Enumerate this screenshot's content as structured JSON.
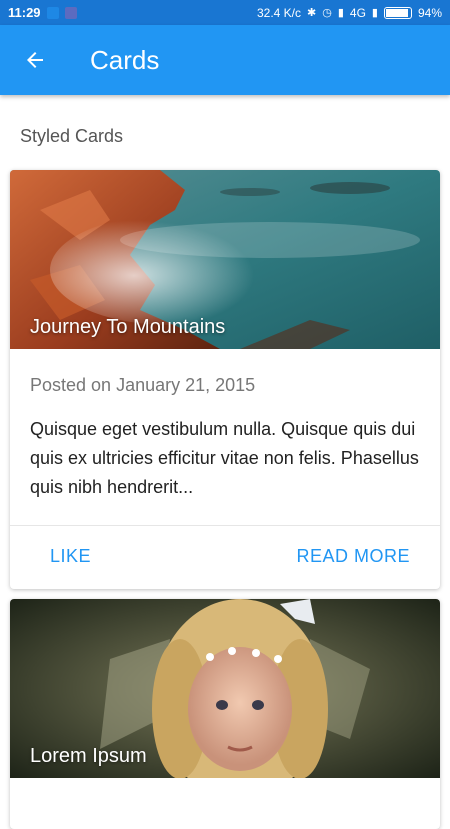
{
  "status_bar": {
    "time": "11:29",
    "network_speed": "32.4 K/c",
    "network_type": "4G",
    "battery": "94%",
    "battery_level": 0.94,
    "app_colors": [
      "#1e88e5",
      "#5c6bc0"
    ]
  },
  "app_bar": {
    "back_icon": "arrow-left-icon",
    "title": "Cards"
  },
  "section_title": "Styled Cards",
  "cards": [
    {
      "image_title": "Journey To Mountains",
      "subtitle": "Posted on January 21, 2015",
      "text": "Quisque eget vestibulum nulla. Quisque quis dui quis ex ultricies efficitur vitae non felis. Phasellus quis nibh hendrerit...",
      "actions": [
        "LIKE",
        "READ MORE"
      ]
    },
    {
      "image_title": "Lorem Ipsum"
    }
  ],
  "colors": {
    "status_bar": "#1976d2",
    "app_bar": "#2196f3",
    "accent": "#2196f3"
  }
}
